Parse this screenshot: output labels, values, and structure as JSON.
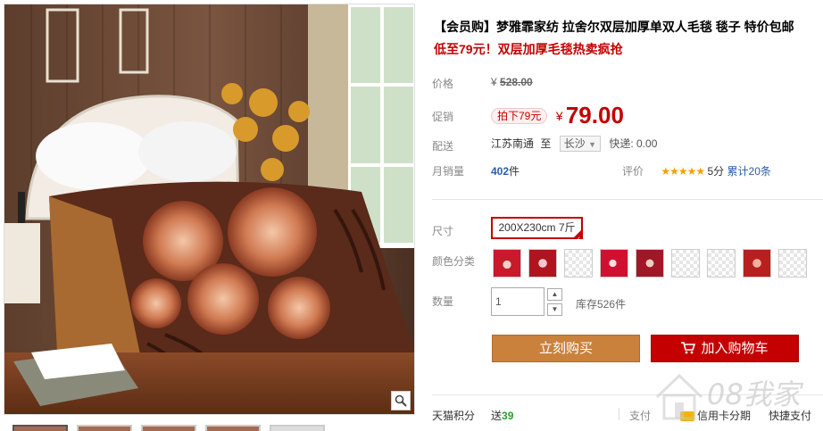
{
  "product": {
    "title": "【会员购】梦雅霏家纺 拉舍尔双层加厚单双人毛毯 毯子 特价包邮",
    "subtitle": "低至79元！双层加厚毛毯热卖疯抢"
  },
  "price": {
    "label": "价格",
    "original": "528.00",
    "currency": "¥",
    "promo_label": "促销",
    "promo_badge": "拍下79元",
    "current": "79.00"
  },
  "shipping": {
    "label": "配送",
    "from": "江苏南通",
    "to_word": "至",
    "destination": "长沙",
    "express": "快递: 0.00"
  },
  "sales": {
    "label": "月销量",
    "count": "402",
    "unit": "件",
    "rating_label": "评价",
    "stars": "★★★★★",
    "score": "5分",
    "reviews": "累计20条"
  },
  "options": {
    "size_label": "尺寸",
    "size_value": "200X230cm 7斤",
    "color_label": "颜色分类",
    "swatches": [
      "red1",
      "red2",
      "mosaic",
      "red3",
      "red4",
      "mosaic",
      "mosaic",
      "red5",
      "mosaic"
    ]
  },
  "quantity": {
    "label": "数量",
    "value": "1",
    "stock": "库存526件"
  },
  "actions": {
    "buy_now": "立刻购买",
    "add_to_cart": "加入购物车"
  },
  "footer": {
    "points_label": "天猫积分",
    "points_prefix": "送",
    "points_value": "39",
    "pay_label": "支付",
    "installment": "信用卡分期",
    "quick_pay": "快捷支付"
  },
  "watermark": {
    "text": "08我家"
  },
  "colors": {
    "accent_red": "#c40000",
    "buy_orange": "#c9813c"
  }
}
